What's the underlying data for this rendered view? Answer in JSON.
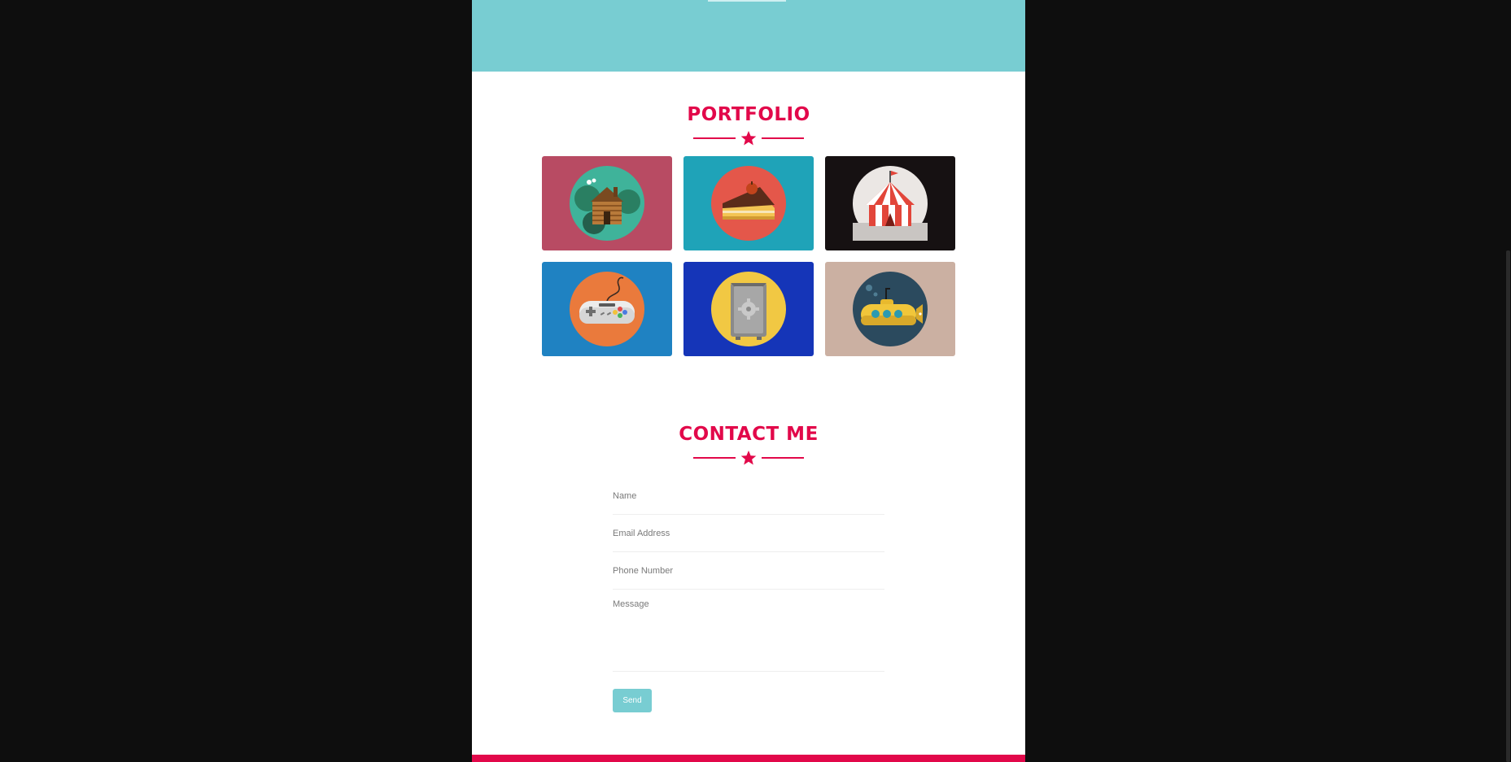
{
  "portfolio": {
    "title": "PORTFOLIO",
    "items": [
      {
        "icon": "log-cabin-icon",
        "bg": "#b84b63"
      },
      {
        "icon": "cake-slice-icon",
        "bg": "#1fa3b8"
      },
      {
        "icon": "circus-tent-icon",
        "bg": "#161112"
      },
      {
        "icon": "game-controller-icon",
        "bg": "#1f82c2"
      },
      {
        "icon": "safe-icon",
        "bg": "#1535b8"
      },
      {
        "icon": "submarine-icon",
        "bg": "#cbb0a2"
      }
    ]
  },
  "contact": {
    "title": "CONTACT ME",
    "name_placeholder": "Name",
    "email_placeholder": "Email Address",
    "phone_placeholder": "Phone Number",
    "message_placeholder": "Message",
    "send_label": "Send"
  },
  "colors": {
    "accent": "#e2084a",
    "teal": "#78cdd2",
    "page_bg": "#ffffff",
    "outer_bg": "#0e0e0e"
  }
}
